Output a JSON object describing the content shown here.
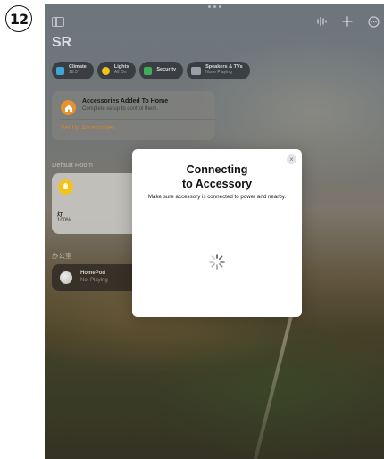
{
  "step_badge": "12",
  "home": {
    "title": "SR"
  },
  "top_actions": [
    {
      "icon": "waveform-icon",
      "glyph": "⁞⁞"
    },
    {
      "icon": "plus-icon",
      "glyph": "+"
    },
    {
      "icon": "more-icon",
      "glyph": "⊖"
    }
  ],
  "chips": [
    {
      "title": "Climate",
      "sub": "18.5°",
      "color": "#3ca6d9"
    },
    {
      "title": "Lights",
      "sub": "All On",
      "color": "#f3c21b"
    },
    {
      "title": "Security",
      "sub": "",
      "color": "#3fae5a"
    },
    {
      "title": "Speakers & TVs",
      "sub": "None Playing",
      "color": "#9a9ea6"
    }
  ],
  "accessories_card": {
    "title": "Accessories Added To Home",
    "subtitle": "Complete setup to control them.",
    "link": "Set Up Accessories"
  },
  "rooms": {
    "default_room": "Default Room",
    "office": "办公室"
  },
  "light_tile": {
    "name": "灯",
    "value": "100%"
  },
  "homepod_tile": {
    "name": "HomePod",
    "status": "Not Playing"
  },
  "modal": {
    "title_line1": "Connecting",
    "title_line2": "to Accessory",
    "subtitle": "Make sure accessory is connected to power and nearby.",
    "close_glyph": "×"
  },
  "colors": {
    "accent_orange": "#e8912f",
    "link_orange": "#d9852c",
    "bulb_yellow": "#f3c21b"
  }
}
